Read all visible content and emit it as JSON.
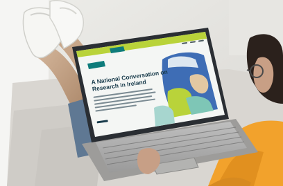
{
  "photo": {
    "subject": "person on a sofa using a laptop showing a website",
    "icons": [
      "laptop-icon",
      "sneaker-icon",
      "glasses-icon"
    ]
  },
  "website": {
    "nav_items": [
      "",
      "",
      ""
    ],
    "headline_lines": [
      "A National Conversation on",
      "Research in Ireland"
    ],
    "cta_label": ""
  },
  "colors": {
    "site_accent": "#b9d33a",
    "site_header": "#0e7c7b",
    "sweater": "#f2a22c",
    "sofa": "#d9d6d1"
  }
}
